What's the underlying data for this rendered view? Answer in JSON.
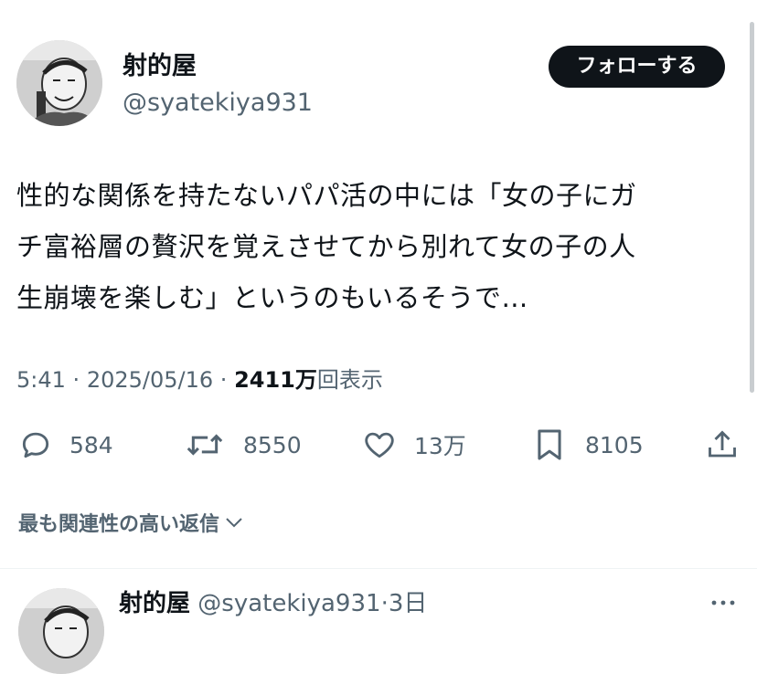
{
  "tweet": {
    "author_name": "射的屋",
    "author_handle": "@syatekiya931",
    "follow_label": "フォローする",
    "text_lines": [
      "性的な関係を持たないパパ活の中には「女の子にガ",
      "チ富裕層の贅沢を覚えさせてから別れて女の子の人",
      "生崩壊を楽しむ」というのもいるそうで…"
    ],
    "time": "5:41",
    "date": "2025/05/16",
    "views_count": "2411万",
    "views_label": "回表示",
    "separator": "·"
  },
  "actions": {
    "reply_count": "584",
    "retweet_count": "8550",
    "like_count": "13万",
    "bookmark_count": "8105"
  },
  "replies_section": {
    "header": "最も関連性の高い返信"
  },
  "reply": {
    "author_name": "射的屋",
    "author_handle": "@syatekiya931",
    "time_ago": "3日",
    "separator": "·"
  },
  "colors": {
    "text": "#0f1419",
    "secondary": "#536471",
    "button_bg": "#0f1419"
  }
}
